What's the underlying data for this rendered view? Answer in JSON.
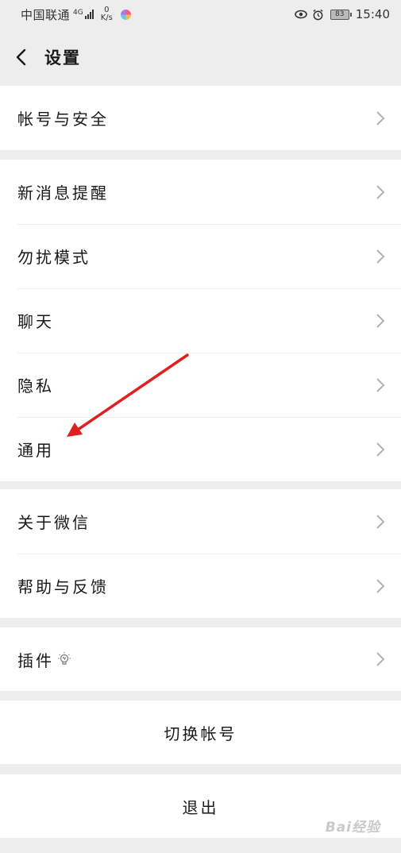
{
  "status_bar": {
    "carrier": "中国联通",
    "network": "4G",
    "speed_value": "0",
    "speed_unit": "K/s",
    "battery": "83",
    "time": "15:40"
  },
  "nav": {
    "title": "设置",
    "back_icon": "chevron-left-icon"
  },
  "groups": {
    "account": {
      "items": [
        "帐号与安全"
      ]
    },
    "main": {
      "items": [
        "新消息提醒",
        "勿扰模式",
        "聊天",
        "隐私",
        "通用"
      ]
    },
    "about": {
      "items": [
        "关于微信",
        "帮助与反馈"
      ]
    },
    "plugins": {
      "items": [
        "插件"
      ]
    },
    "switch_account": "切换帐号",
    "logout": "退出"
  },
  "annotation": {
    "arrow_color": "#e02020",
    "target": "通用"
  },
  "watermark": "Bai经验",
  "colors": {
    "background": "#ededed",
    "card": "#ffffff",
    "text": "#191919",
    "chevron": "#b2b2b2"
  }
}
